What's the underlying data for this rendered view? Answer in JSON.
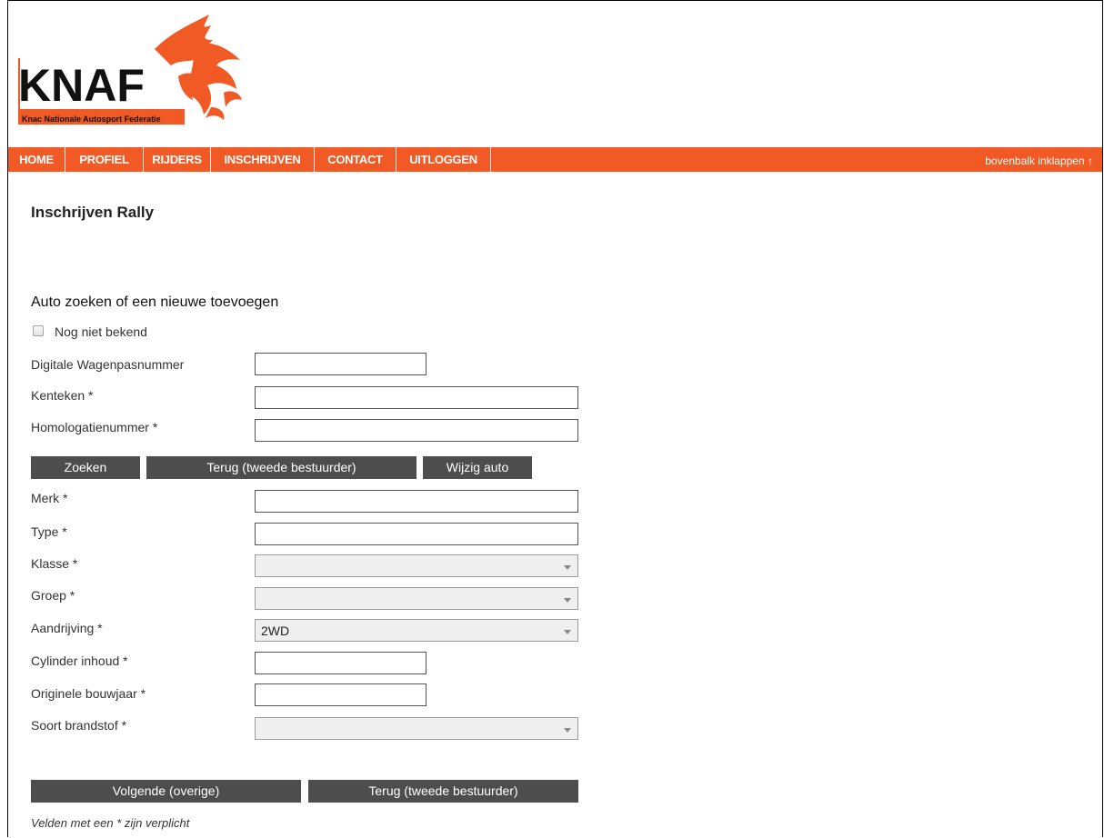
{
  "logo": {
    "text": "KNAF",
    "subtitle": "Knac Nationale Autosport Federatie"
  },
  "nav": {
    "items": [
      "HOME",
      "PROFIEL",
      "RIJDERS",
      "INSCHRIJVEN",
      "CONTACT",
      "UITLOGGEN"
    ],
    "collapse": "bovenbalk inklappen ↑"
  },
  "page": {
    "title": "Inschrijven Rally",
    "section_title": "Auto zoeken of een nieuwe toevoegen",
    "unknown_checkbox": "Nog niet bekend"
  },
  "form": {
    "wagenpas_label": "Digitale Wagenpasnummer",
    "wagenpas_value": "",
    "kenteken_label": "Kenteken *",
    "kenteken_value": "",
    "homologatie_label": "Homologatienummer *",
    "homologatie_value": "",
    "merk_label": "Merk *",
    "merk_value": "",
    "type_label": "Type *",
    "type_value": "",
    "klasse_label": "Klasse *",
    "klasse_value": "",
    "groep_label": "Groep *",
    "groep_value": "",
    "aandrijving_label": "Aandrijving *",
    "aandrijving_value": "2WD",
    "cylinder_label": "Cylinder inhoud *",
    "cylinder_value": "",
    "bouwjaar_label": "Originele bouwjaar *",
    "bouwjaar_value": "",
    "brandstof_label": "Soort brandstof *",
    "brandstof_value": ""
  },
  "buttons": {
    "zoeken": "Zoeken",
    "terug_top": "Terug (tweede bestuurder)",
    "wijzig": "Wijzig auto",
    "volgende": "Volgende (overige)",
    "terug_bottom": "Terug (tweede bestuurder)"
  },
  "footnote": "Velden met een * zijn verplicht",
  "colors": {
    "accent": "#f15a24",
    "button": "#4d4d4d"
  }
}
